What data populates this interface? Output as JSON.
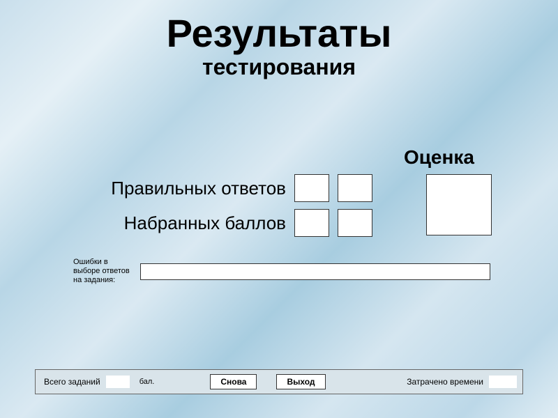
{
  "title": {
    "main": "Результаты",
    "sub": "тестирования"
  },
  "grade_label": "Оценка",
  "rows": {
    "correct_label": "Правильных ответов",
    "points_label": "Набранных баллов"
  },
  "errors_label": "Ошибки в выборе ответов на задания:",
  "footer": {
    "total_label": "Всего заданий",
    "bal": "бал.",
    "again": "Снова",
    "exit": "Выход",
    "time_label": "Затрачено времени"
  }
}
